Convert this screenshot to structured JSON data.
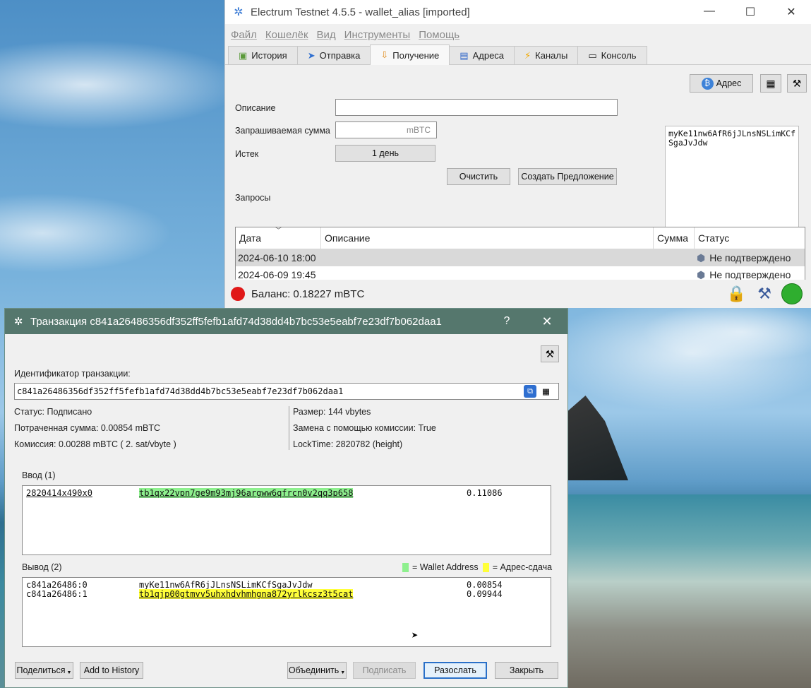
{
  "main_window": {
    "title": "Electrum Testnet 4.5.5  -  wallet_alias  [imported]",
    "controls": {
      "minimize": "—",
      "maximize": "☐",
      "close": "✕"
    },
    "menu": [
      "Файл",
      "Кошелёк",
      "Вид",
      "Инструменты",
      "Помощь"
    ],
    "tabs": [
      {
        "label": "История",
        "icon": "history-icon"
      },
      {
        "label": "Отправка",
        "icon": "send-icon"
      },
      {
        "label": "Получение",
        "icon": "receive-icon",
        "active": true
      },
      {
        "label": "Адреса",
        "icon": "addresses-icon"
      },
      {
        "label": "Каналы",
        "icon": "lightning-icon"
      },
      {
        "label": "Консоль",
        "icon": "console-icon"
      }
    ],
    "receive": {
      "address_button": "Адрес",
      "description_label": "Описание",
      "description_value": "",
      "amount_label": "Запрашиваемая сумма",
      "amount_unit": "mBTC",
      "expiry_label": "Истек",
      "expiry_value": "1 день",
      "clear_button": "Очистить",
      "create_button": "Создать Предложение",
      "requests_label": "Запросы",
      "address_display": "myKe11nw6AfR6jJLnsNSLimKCfSgaJvJdw"
    },
    "requests_table": {
      "columns": [
        "Дата",
        "Описание",
        "Сумма",
        "Статус"
      ],
      "rows": [
        {
          "date": "2024-06-10 18:00",
          "description": "",
          "amount": "",
          "status": "Не подтверждено"
        },
        {
          "date": "2024-06-09 19:45",
          "description": "",
          "amount": "",
          "status": "Не подтверждено"
        }
      ]
    },
    "status_bar": {
      "balance": "Баланс: 0.18227 mBTC"
    }
  },
  "tx_dialog": {
    "title": "Транзакция c841a26486356df352ff5fefb1afd74d38dd4b7bc53e5eabf7e23df7b062daa1",
    "help": "?",
    "close": "✕",
    "txid_label": "Идентификатор транзакции:",
    "txid": "c841a26486356df352ff5fefb1afd74d38dd4b7bc53e5eabf7e23df7b062daa1",
    "status": "Статус: Подписано",
    "amount_spent": "Потраченная сумма: 0.00854 mBTC",
    "fee": "Комиссия: 0.00288 mBTC  ( 2. sat/vbyte )",
    "size": "Размер: 144 vbytes",
    "rbf": "Замена с помощью комиссии: True",
    "locktime": "LockTime: 2820782 (height)",
    "inputs_label": "Ввод (1)",
    "inputs": [
      {
        "outpoint": "2820414x490x0",
        "address": "tb1qx22vpn7ge9m93mj96argww6qfrcn0v2qq3p658",
        "amount": "0.11086"
      }
    ],
    "outputs_label": "Вывод (2)",
    "legend_wallet": "= Wallet Address",
    "legend_change": "= Адрес-сдача",
    "outputs": [
      {
        "outpoint": "c841a26486:0",
        "address": "myKe11nw6AfR6jJLnsNSLimKCfSgaJvJdw",
        "amount": "0.00854"
      },
      {
        "outpoint": "c841a26486:1",
        "address": "tb1qjp00gtmvv5uhxhdvhmhgna872yrlkcsz3t5cat",
        "amount": "0.09944"
      }
    ],
    "buttons": {
      "share": "Поделиться",
      "add_history": "Add to History",
      "combine": "Объединить",
      "sign": "Подписать",
      "broadcast": "Разослать",
      "close": "Закрыть"
    },
    "colors": {
      "wallet": "#8ef08e",
      "change": "#ffff3a"
    }
  }
}
